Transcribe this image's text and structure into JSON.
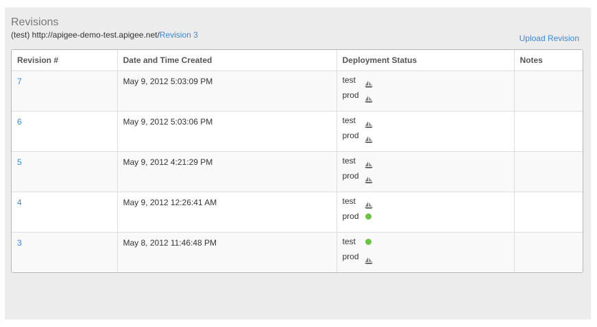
{
  "page": {
    "title": "Revisions",
    "env_prefix": "(test) http://apigee-demo-test.apigee.net/",
    "current_revision_link": "Revision 3",
    "upload_label": "Upload Revision"
  },
  "table": {
    "headers": [
      "Revision #",
      "Date and Time Created",
      "Deployment Status",
      "Notes"
    ],
    "rows": [
      {
        "revision": "7",
        "created": "May 9, 2012 5:03:09 PM",
        "deployments": [
          {
            "env": "test",
            "icon": "ship-icon"
          },
          {
            "env": "prod",
            "icon": "ship-icon"
          }
        ],
        "notes": ""
      },
      {
        "revision": "6",
        "created": "May 9, 2012 5:03:06 PM",
        "deployments": [
          {
            "env": "test",
            "icon": "ship-icon"
          },
          {
            "env": "prod",
            "icon": "ship-icon"
          }
        ],
        "notes": ""
      },
      {
        "revision": "5",
        "created": "May 9, 2012 4:21:29 PM",
        "deployments": [
          {
            "env": "test",
            "icon": "ship-icon"
          },
          {
            "env": "prod",
            "icon": "ship-icon"
          }
        ],
        "notes": ""
      },
      {
        "revision": "4",
        "created": "May 9, 2012 12:26:41 AM",
        "deployments": [
          {
            "env": "test",
            "icon": "ship-icon"
          },
          {
            "env": "prod",
            "icon": "deployed-dot-icon"
          }
        ],
        "notes": ""
      },
      {
        "revision": "3",
        "created": "May 8, 2012 11:46:48 PM",
        "deployments": [
          {
            "env": "test",
            "icon": "deployed-dot-icon"
          },
          {
            "env": "prod",
            "icon": "ship-icon"
          }
        ],
        "notes": ""
      }
    ]
  },
  "colors": {
    "link": "#3a87d6",
    "deployed": "#68c442",
    "panel_bg": "#ececec"
  }
}
